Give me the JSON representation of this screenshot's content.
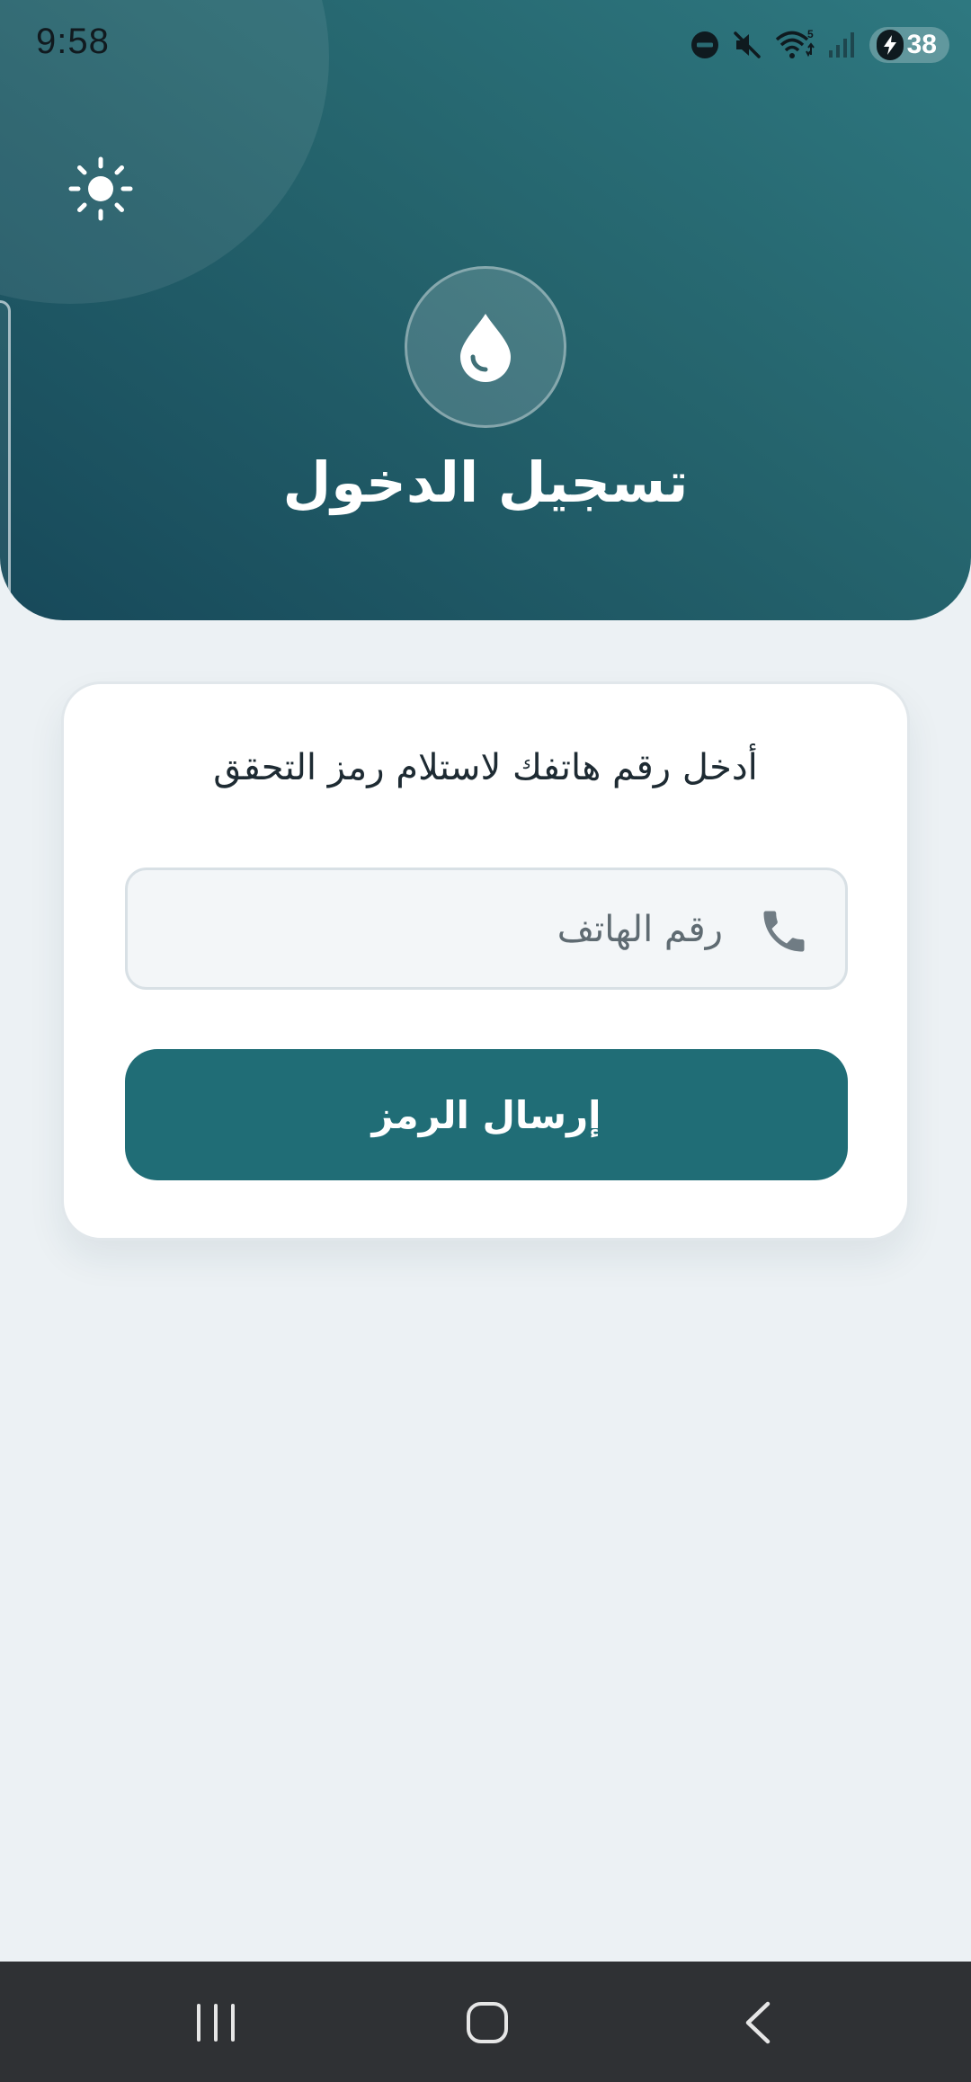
{
  "status_bar": {
    "time": "9:58",
    "battery_level": "38",
    "icons": [
      "do-not-disturb-icon",
      "mute-icon",
      "wifi-icon",
      "signal-icon",
      "battery-charging-icon"
    ]
  },
  "header": {
    "title": "تسجيل الدخول",
    "logo_icon": "water-drop-icon",
    "theme_toggle_icon": "sun-icon"
  },
  "login_card": {
    "instruction": "أدخل رقم هاتفك لاستلام رمز التحقق",
    "phone_field": {
      "value": "",
      "placeholder": "رقم الهاتف",
      "icon": "phone-icon"
    },
    "send_button_label": "إرسال الرمز"
  },
  "navigation_bar": {
    "buttons": [
      "recent-apps",
      "home",
      "back"
    ]
  },
  "colors": {
    "header_start": "#17495a",
    "header_end": "#2e7880",
    "primary_button": "#206d76",
    "background": "#ecf1f4",
    "card": "#ffffff"
  }
}
